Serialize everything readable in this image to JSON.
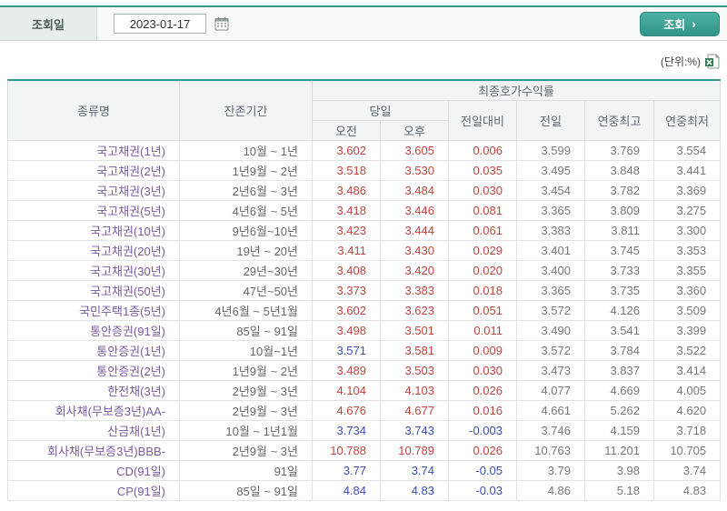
{
  "page": {
    "unit_label": "(단위:%)"
  },
  "form": {
    "date_label": "조회일",
    "date_value": "2023-01-17",
    "search_button": "조회",
    "search_button_arrow": "›"
  },
  "icons": {
    "calendar": "calendar-icon",
    "excel": "excel-export-icon"
  },
  "colors": {
    "up": "#c0443f",
    "down": "#3b4db4",
    "neutral": "#787878",
    "teal": "#339488",
    "teal_dark": "#37988a",
    "name_purple": "#7a5b9e"
  },
  "table": {
    "headers": {
      "name": "종류명",
      "period": "잔존기간",
      "yield_group": "최종호가수익률",
      "today": "당일",
      "am": "오전",
      "pm": "오후",
      "diff": "전일대비",
      "prev": "전일",
      "year_high": "연중최고",
      "year_low": "연중최저"
    },
    "rows": [
      {
        "name": "국고채권(1년)",
        "period": "10월 ~ 1년",
        "am": "3.602",
        "pm": "3.605",
        "diff": "0.006",
        "prev": "3.599",
        "high": "3.769",
        "low": "3.554",
        "am_trend": "up",
        "pm_trend": "up",
        "diff_trend": "up"
      },
      {
        "name": "국고채권(2년)",
        "period": "1년9월 ~ 2년",
        "am": "3.518",
        "pm": "3.530",
        "diff": "0.035",
        "prev": "3.495",
        "high": "3.848",
        "low": "3.441",
        "am_trend": "up",
        "pm_trend": "up",
        "diff_trend": "up"
      },
      {
        "name": "국고채권(3년)",
        "period": "2년6월 ~ 3년",
        "am": "3.486",
        "pm": "3.484",
        "diff": "0.030",
        "prev": "3.454",
        "high": "3.782",
        "low": "3.369",
        "am_trend": "up",
        "pm_trend": "up",
        "diff_trend": "up"
      },
      {
        "name": "국고채권(5년)",
        "period": "4년6월 ~ 5년",
        "am": "3.418",
        "pm": "3.446",
        "diff": "0.081",
        "prev": "3.365",
        "high": "3.809",
        "low": "3.275",
        "am_trend": "up",
        "pm_trend": "up",
        "diff_trend": "up"
      },
      {
        "name": "국고채권(10년)",
        "period": "9년6월~10년",
        "am": "3.423",
        "pm": "3.444",
        "diff": "0.061",
        "prev": "3.383",
        "high": "3.811",
        "low": "3.300",
        "am_trend": "up",
        "pm_trend": "up",
        "diff_trend": "up"
      },
      {
        "name": "국고채권(20년)",
        "period": "19년 ~ 20년",
        "am": "3.411",
        "pm": "3.430",
        "diff": "0.029",
        "prev": "3.401",
        "high": "3.745",
        "low": "3.353",
        "am_trend": "up",
        "pm_trend": "up",
        "diff_trend": "up"
      },
      {
        "name": "국고채권(30년)",
        "period": "29년~30년",
        "am": "3.408",
        "pm": "3.420",
        "diff": "0.020",
        "prev": "3.400",
        "high": "3.733",
        "low": "3.355",
        "am_trend": "up",
        "pm_trend": "up",
        "diff_trend": "up"
      },
      {
        "name": "국고채권(50년)",
        "period": "47년~50년",
        "am": "3.373",
        "pm": "3.383",
        "diff": "0.018",
        "prev": "3.365",
        "high": "3.735",
        "low": "3.360",
        "am_trend": "up",
        "pm_trend": "up",
        "diff_trend": "up"
      },
      {
        "name": "국민주택1종(5년)",
        "period": "4년6월 ~ 5년1월",
        "am": "3.602",
        "pm": "3.623",
        "diff": "0.051",
        "prev": "3.572",
        "high": "4.126",
        "low": "3.509",
        "am_trend": "up",
        "pm_trend": "up",
        "diff_trend": "up"
      },
      {
        "name": "통안증권(91일)",
        "period": "85일 ~ 91일",
        "am": "3.498",
        "pm": "3.501",
        "diff": "0.011",
        "prev": "3.490",
        "high": "3.541",
        "low": "3.399",
        "am_trend": "up",
        "pm_trend": "up",
        "diff_trend": "up"
      },
      {
        "name": "통안증권(1년)",
        "period": "10월~1년",
        "am": "3.571",
        "pm": "3.581",
        "diff": "0.009",
        "prev": "3.572",
        "high": "3.784",
        "low": "3.522",
        "am_trend": "down",
        "pm_trend": "up",
        "diff_trend": "up"
      },
      {
        "name": "통안증권(2년)",
        "period": "1년9월 ~ 2년",
        "am": "3.489",
        "pm": "3.503",
        "diff": "0.030",
        "prev": "3.473",
        "high": "3.837",
        "low": "3.414",
        "am_trend": "up",
        "pm_trend": "up",
        "diff_trend": "up"
      },
      {
        "name": "한전채(3년)",
        "period": "2년9월 ~ 3년",
        "am": "4.104",
        "pm": "4.103",
        "diff": "0.026",
        "prev": "4.077",
        "high": "4.669",
        "low": "4.005",
        "am_trend": "up",
        "pm_trend": "up",
        "diff_trend": "up"
      },
      {
        "name": "회사채(무보증3년)AA-",
        "period": "2년9월 ~ 3년",
        "am": "4.676",
        "pm": "4.677",
        "diff": "0.016",
        "prev": "4.661",
        "high": "5.262",
        "low": "4.620",
        "am_trend": "up",
        "pm_trend": "up",
        "diff_trend": "up"
      },
      {
        "name": "산금채(1년)",
        "period": "10월 ~ 1년1월",
        "am": "3.734",
        "pm": "3.743",
        "diff": "-0.003",
        "prev": "3.746",
        "high": "4.159",
        "low": "3.718",
        "am_trend": "down",
        "pm_trend": "down",
        "diff_trend": "down"
      },
      {
        "name": "회사채(무보증3년)BBB-",
        "period": "2년9월 ~ 3년",
        "am": "10.788",
        "pm": "10.789",
        "diff": "0.026",
        "prev": "10.763",
        "high": "11.201",
        "low": "10.705",
        "am_trend": "up",
        "pm_trend": "up",
        "diff_trend": "up"
      },
      {
        "name": "CD(91일)",
        "period": "91일",
        "am": "3.77",
        "pm": "3.74",
        "diff": "-0.05",
        "prev": "3.79",
        "high": "3.98",
        "low": "3.74",
        "am_trend": "down",
        "pm_trend": "down",
        "diff_trend": "down"
      },
      {
        "name": "CP(91일)",
        "period": "85일 ~ 91일",
        "am": "4.84",
        "pm": "4.83",
        "diff": "-0.03",
        "prev": "4.86",
        "high": "5.18",
        "low": "4.83",
        "am_trend": "down",
        "pm_trend": "down",
        "diff_trend": "down"
      }
    ]
  }
}
